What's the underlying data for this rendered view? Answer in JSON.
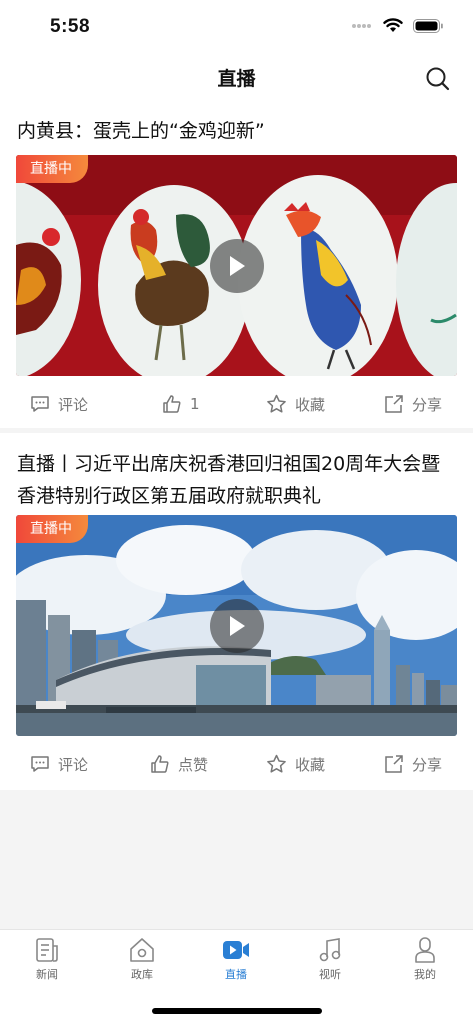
{
  "status_bar": {
    "time": "5:58"
  },
  "nav": {
    "title": "直播"
  },
  "cards": [
    {
      "title": "内黄县：蛋壳上的“金鸡迎新”",
      "badge": "直播中",
      "actions": {
        "comment": "评论",
        "like": "1",
        "favorite": "收藏",
        "share": "分享"
      }
    },
    {
      "title": "直播丨习近平出席庆祝香港回归祖国20周年大会暨香港特别行政区第五届政府就职典礼",
      "badge": "直播中",
      "actions": {
        "comment": "评论",
        "like": "点赞",
        "favorite": "收藏",
        "share": "分享"
      }
    }
  ],
  "tabs": [
    {
      "label": "新闻",
      "icon": "news-icon"
    },
    {
      "label": "政库",
      "icon": "government-icon"
    },
    {
      "label": "直播",
      "icon": "live-video-icon"
    },
    {
      "label": "视听",
      "icon": "music-icon"
    },
    {
      "label": "我的",
      "icon": "profile-icon"
    }
  ],
  "colors": {
    "accent": "#2a7fd4",
    "live_badge": "#f0483a"
  }
}
